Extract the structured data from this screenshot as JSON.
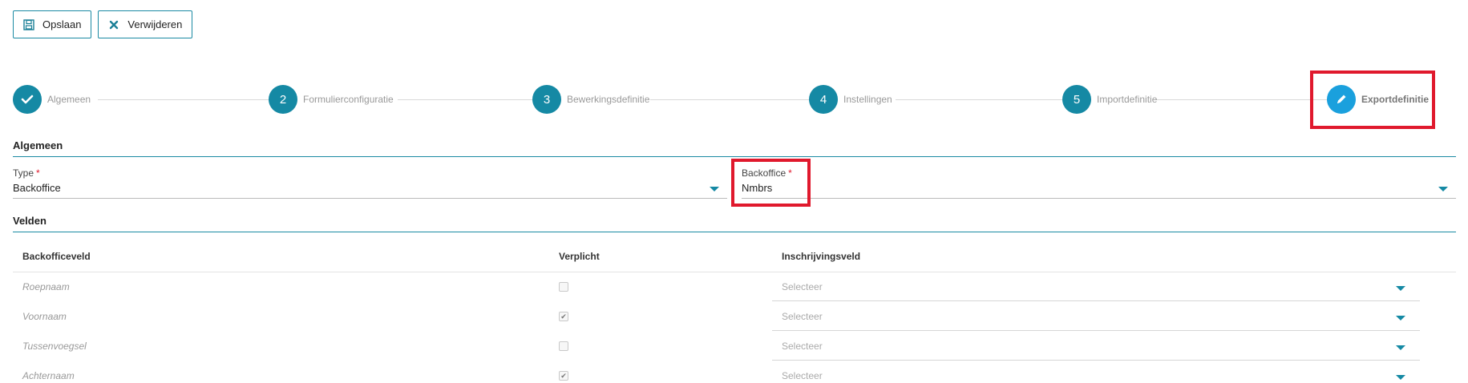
{
  "toolbar": {
    "save_label": "Opslaan",
    "delete_label": "Verwijderen"
  },
  "steps": [
    {
      "number": "",
      "label": "Algemeen",
      "state": "completed"
    },
    {
      "number": "2",
      "label": "Formulierconfiguratie",
      "state": "default"
    },
    {
      "number": "3",
      "label": "Bewerkingsdefinitie",
      "state": "default"
    },
    {
      "number": "4",
      "label": "Instellingen",
      "state": "default"
    },
    {
      "number": "5",
      "label": "Importdefinitie",
      "state": "default"
    },
    {
      "number": "",
      "label": "Exportdefinitie",
      "state": "active"
    }
  ],
  "algemeen": {
    "title": "Algemeen",
    "type_label": "Type",
    "type_value": "Backoffice",
    "backoffice_label": "Backoffice",
    "backoffice_value": "Nmbrs",
    "required_marker": "*"
  },
  "velden": {
    "title": "Velden",
    "columns": [
      "Backofficeveld",
      "Verplicht",
      "Inschrijvingsveld"
    ],
    "rows": [
      {
        "name": "Roepnaam",
        "required": false,
        "select": "Selecteer"
      },
      {
        "name": "Voornaam",
        "required": true,
        "select": "Selecteer"
      },
      {
        "name": "Tussenvoegsel",
        "required": false,
        "select": "Selecteer"
      },
      {
        "name": "Achternaam",
        "required": true,
        "select": "Selecteer"
      }
    ]
  },
  "colors": {
    "accent": "#1589a4",
    "active_step": "#1aa0dd",
    "highlight": "#e0192d"
  }
}
